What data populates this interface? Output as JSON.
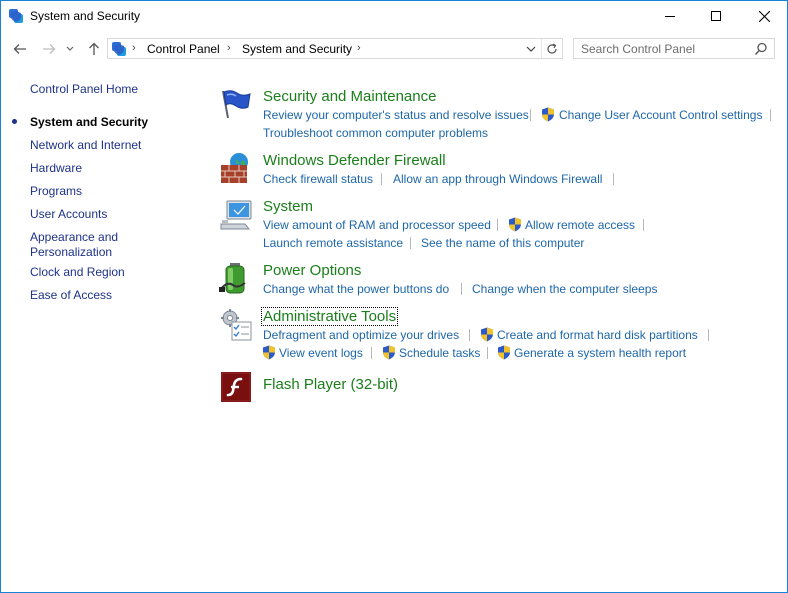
{
  "window": {
    "title": "System and Security"
  },
  "address": {
    "crumbs": [
      "Control Panel",
      "System and Security"
    ]
  },
  "search": {
    "placeholder": "Search Control Panel"
  },
  "sidebar": {
    "home": "Control Panel Home",
    "items": [
      {
        "label": "System and Security",
        "current": true
      },
      {
        "label": "Network and Internet"
      },
      {
        "label": "Hardware"
      },
      {
        "label": "Programs"
      },
      {
        "label": "User Accounts"
      },
      {
        "label": "Appearance and"
      },
      {
        "label": "Personalization"
      },
      {
        "label": "Clock and Region"
      },
      {
        "label": "Ease of Access"
      }
    ]
  },
  "categories": {
    "security": {
      "title": "Security and Maintenance",
      "icon": "flag-icon",
      "links": [
        "Review your computer's status and resolve issues",
        "Change User Account Control settings",
        "Troubleshoot common computer problems"
      ]
    },
    "firewall": {
      "title": "Windows Defender Firewall",
      "icon": "firewall-icon",
      "links": [
        "Check firewall status",
        "Allow an app through Windows Firewall"
      ]
    },
    "system": {
      "title": "System",
      "icon": "computer-icon",
      "links": [
        "View amount of RAM and processor speed",
        "Allow remote access",
        "Launch remote assistance",
        "See the name of this computer"
      ]
    },
    "power": {
      "title": "Power Options",
      "icon": "battery-icon",
      "links": [
        "Change what the power buttons do",
        "Change when the computer sleeps"
      ]
    },
    "admin": {
      "title": "Administrative Tools",
      "icon": "admin-tools-icon",
      "links": [
        "Defragment and optimize your drives",
        "Create and format hard disk partitions",
        "View event logs",
        "Schedule tasks",
        "Generate a system health report"
      ]
    },
    "flash": {
      "title": "Flash Player (32-bit)",
      "icon": "flash-icon"
    }
  },
  "colors": {
    "link": "#1e66a8",
    "category_title": "#1a7f1a",
    "sidebar_link": "#1e3287"
  }
}
